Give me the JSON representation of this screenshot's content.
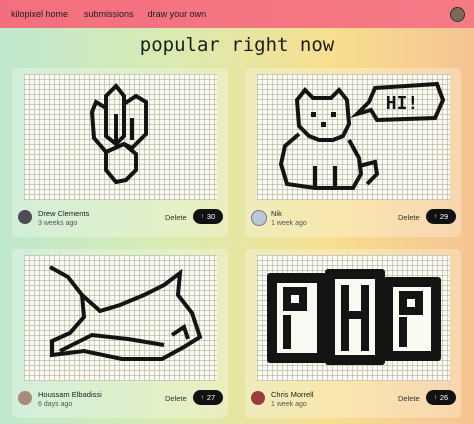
{
  "nav": {
    "brand": "kilopixel home",
    "links": [
      "submissions",
      "draw your own"
    ]
  },
  "page_title": "popular right now",
  "cards": [
    {
      "author": "Drew Clements",
      "time": "3 weeks ago",
      "delete_label": "Delete",
      "votes": "30"
    },
    {
      "author": "Nik",
      "time": "1 week ago",
      "delete_label": "Delete",
      "votes": "29"
    },
    {
      "author": "Houssam Elbadissi",
      "time": "6 days ago",
      "delete_label": "Delete",
      "votes": "27"
    },
    {
      "author": "Chris Morrell",
      "time": "1 week ago",
      "delete_label": "Delete",
      "votes": "26"
    }
  ],
  "speech_text": "HI!",
  "colors": {
    "nav": "#f4737f",
    "pixel": "#141414",
    "vote_bg": "#111111"
  }
}
